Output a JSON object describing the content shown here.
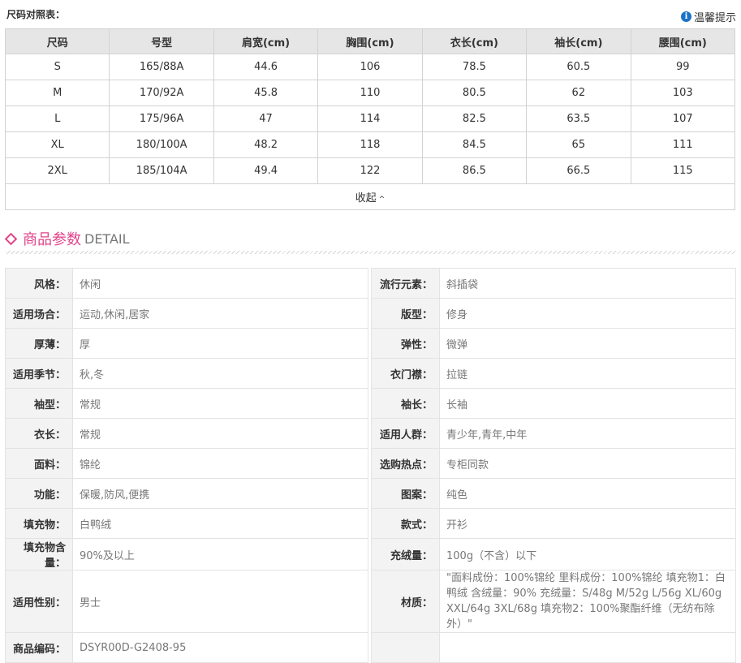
{
  "size_chart": {
    "title": "尺码对照表：",
    "tips_label": "温馨提示",
    "headers": [
      "尺码",
      "号型",
      "肩宽(cm)",
      "胸围(cm)",
      "衣长(cm)",
      "袖长(cm)",
      "腰围(cm)"
    ],
    "rows": [
      [
        "S",
        "165/88A",
        "44.6",
        "106",
        "78.5",
        "60.5",
        "99"
      ],
      [
        "M",
        "170/92A",
        "45.8",
        "110",
        "80.5",
        "62",
        "103"
      ],
      [
        "L",
        "175/96A",
        "47",
        "114",
        "82.5",
        "63.5",
        "107"
      ],
      [
        "XL",
        "180/100A",
        "48.2",
        "118",
        "84.5",
        "65",
        "111"
      ],
      [
        "2XL",
        "185/104A",
        "49.4",
        "122",
        "86.5",
        "66.5",
        "115"
      ]
    ],
    "collapse_label": "收起",
    "collapse_icon": "chevron-up-icon"
  },
  "detail": {
    "title_cn": "商品参数",
    "title_en": "DETAIL",
    "accent_color": "#e0438a",
    "rows": [
      {
        "lk": "风格：",
        "lv": "休闲",
        "rk": "流行元素：",
        "rv": "斜插袋"
      },
      {
        "lk": "适用场合：",
        "lv": "运动,休闲,居家",
        "rk": "版型：",
        "rv": "修身"
      },
      {
        "lk": "厚薄：",
        "lv": "厚",
        "rk": "弹性：",
        "rv": "微弹"
      },
      {
        "lk": "适用季节：",
        "lv": "秋,冬",
        "rk": "衣门襟：",
        "rv": "拉链"
      },
      {
        "lk": "袖型：",
        "lv": "常规",
        "rk": "袖长：",
        "rv": "长袖"
      },
      {
        "lk": "衣长：",
        "lv": "常规",
        "rk": "适用人群：",
        "rv": "青少年,青年,中年"
      },
      {
        "lk": "面料：",
        "lv": "锦纶",
        "rk": "选购热点：",
        "rv": "专柜同款"
      },
      {
        "lk": "功能：",
        "lv": "保暖,防风,便携",
        "rk": "图案：",
        "rv": "纯色"
      },
      {
        "lk": "填充物：",
        "lv": "白鸭绒",
        "rk": "款式：",
        "rv": "开衫"
      },
      {
        "lk": "填充物含量：",
        "lv": "90%及以上",
        "rk": "充绒量：",
        "rv": "100g（不含）以下"
      },
      {
        "lk": "适用性别：",
        "lv": "男士",
        "rk": "材质：",
        "rv": "\"面料成份：100%锦纶 里料成份：100%锦纶 填充物1：白鸭绒 含绒量：90% 充绒量：S/48g M/52g L/56g XL/60g XXL/64g 3XL/68g 填充物2：100%聚酯纤维（无纺布除外）\""
      },
      {
        "lk": "商品编码：",
        "lv": "DSYR00D-G2408-95",
        "rk": "",
        "rv": ""
      }
    ]
  }
}
